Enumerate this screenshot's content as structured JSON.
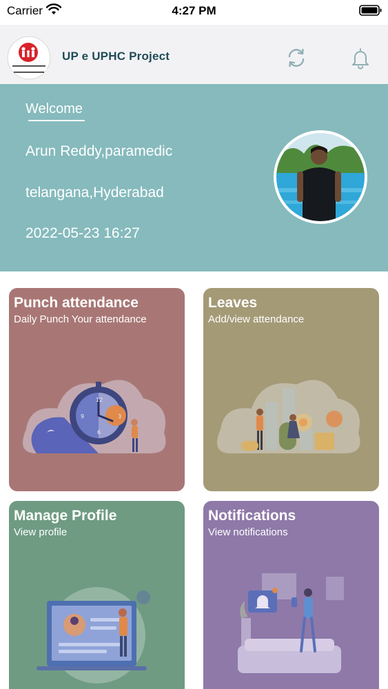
{
  "status_bar": {
    "carrier": "Carrier",
    "time": "4:27 PM"
  },
  "header": {
    "app_title": "UP e UPHC Project",
    "logo_text_top": "NATIONAL HEALTH MISSION",
    "logo_text_bottom": "NATIONAL URBAN HEALTH MISSION",
    "sync_icon": "sync-icon",
    "bell_icon": "bell-icon"
  },
  "welcome": {
    "heading": "Welcome",
    "name_role": "Arun Reddy,paramedic",
    "location": "telangana,Hyderabad",
    "datetime": "2022-05-23 16:27"
  },
  "cards": [
    {
      "title": "Punch attendance",
      "subtitle": "Daily Punch Your attendance",
      "color": "#a87775",
      "illustration": "clock-illustration"
    },
    {
      "title": "Leaves",
      "subtitle": "Add/view attendance",
      "color": "#a49a76",
      "illustration": "bar-chart-illustration"
    },
    {
      "title": "Manage Profile",
      "subtitle": "View profile",
      "color": "#6f9b82",
      "illustration": "profile-illustration"
    },
    {
      "title": "Notifications",
      "subtitle": "View notifications",
      "color": "#8e79a9",
      "illustration": "notification-illustration"
    }
  ],
  "colors": {
    "banner": "#86babd",
    "header_bg": "#f2f2f5",
    "title_text": "#1f4b55"
  }
}
